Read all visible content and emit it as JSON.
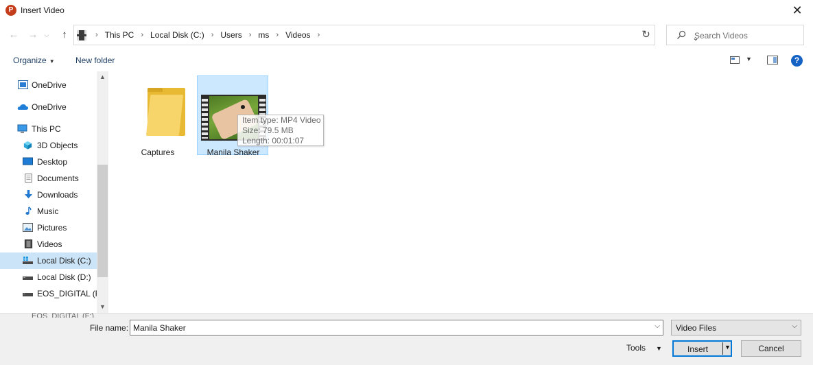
{
  "window": {
    "title": "Insert Video",
    "app_icon_letter": "P"
  },
  "address": {
    "crumbs": [
      "This PC",
      "Local Disk (C:)",
      "Users",
      "ms",
      "Videos"
    ],
    "search_placeholder": "Search Videos"
  },
  "toolbar": {
    "organize_label": "Organize",
    "new_folder_label": "New folder",
    "help_label": "?"
  },
  "sidebar": {
    "items": [
      {
        "label": "OneDrive",
        "icon": "onedrive-business-icon"
      },
      {
        "label": "OneDrive",
        "icon": "onedrive-cloud-icon"
      },
      {
        "label": "This PC",
        "icon": "computer-icon"
      },
      {
        "label": "3D Objects",
        "icon": "cube-icon"
      },
      {
        "label": "Desktop",
        "icon": "desktop-icon"
      },
      {
        "label": "Documents",
        "icon": "documents-icon"
      },
      {
        "label": "Downloads",
        "icon": "download-arrow-icon"
      },
      {
        "label": "Music",
        "icon": "music-note-icon"
      },
      {
        "label": "Pictures",
        "icon": "pictures-icon"
      },
      {
        "label": "Videos",
        "icon": "film-strip-icon"
      },
      {
        "label": "Local Disk (C:)",
        "icon": "drive-icon",
        "selected": true
      },
      {
        "label": "Local Disk (D:)",
        "icon": "drive-icon"
      },
      {
        "label": "EOS_DIGITAL (F:)",
        "icon": "drive-icon"
      }
    ],
    "clipped_label": "EOS_DIGITAL (F:)"
  },
  "files": [
    {
      "name": "Captures",
      "type": "folder"
    },
    {
      "name": "Manila Shaker",
      "type": "video",
      "selected": true
    }
  ],
  "tooltip": {
    "item_type": "Item type: MP4 Video",
    "size": "Size: 79.5 MB",
    "length": "Length: 00:01:07"
  },
  "footer": {
    "file_name_label": "File name:",
    "file_name_value": "Manila Shaker",
    "file_type_value": "Video Files",
    "tools_label": "Tools",
    "insert_label": "Insert",
    "cancel_label": "Cancel"
  },
  "colors": {
    "selection": "#cce4f7",
    "selection_content": "#cce8ff",
    "accent": "#0078d7",
    "help": "#1463c4",
    "link_text": "#1e3f66"
  }
}
